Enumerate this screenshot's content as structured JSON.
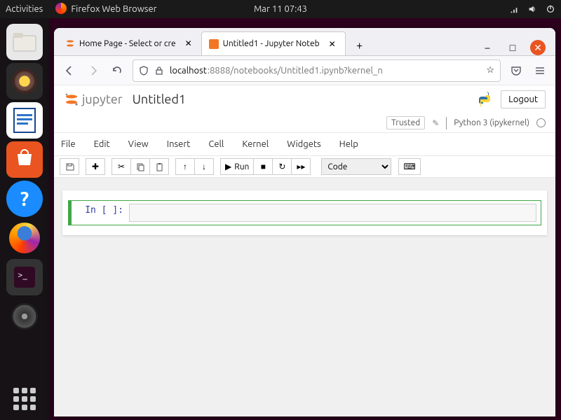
{
  "topbar": {
    "activities": "Activities",
    "app": "Firefox Web Browser",
    "datetime": "Mar 11  07:43"
  },
  "tabs": [
    {
      "label": "Home Page - Select or cre",
      "active": false
    },
    {
      "label": "Untitled1 - Jupyter Noteb",
      "active": true
    }
  ],
  "url": {
    "shield": "shield",
    "host": "localhost",
    "path": ":8888/notebooks/Untitled1.ipynb?kernel_n"
  },
  "jupyter": {
    "brand": "jupyter",
    "notebook_name": "Untitled1",
    "logout": "Logout",
    "trusted": "Trusted",
    "kernel": "Python 3 (ipykernel)",
    "menus": [
      "File",
      "Edit",
      "View",
      "Insert",
      "Cell",
      "Kernel",
      "Widgets",
      "Help"
    ],
    "run": "Run",
    "celltype": "Code",
    "prompt": "In [ ]:"
  }
}
